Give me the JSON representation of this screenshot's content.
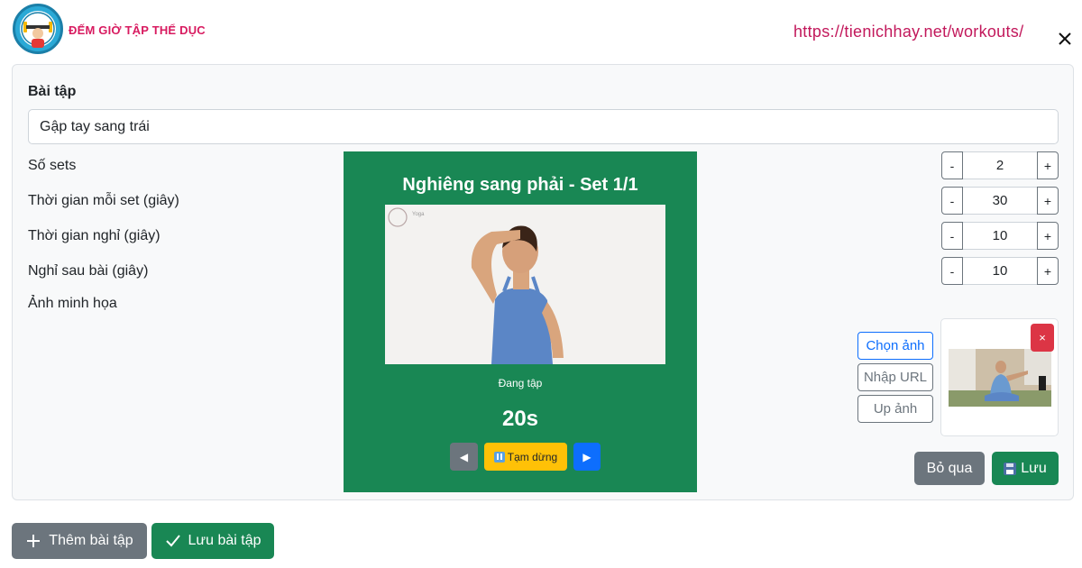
{
  "header": {
    "brand": "ĐẾM GIỜ TẬP THỂ DỤC",
    "url": "https://tienichhay.net/workouts/",
    "logo_icon": "timer-dumbbell-logo",
    "close_icon": "close-icon"
  },
  "form": {
    "exercise_label": "Bài tập",
    "exercise_name": "Gập tay sang trái",
    "sets_label": "Số sets",
    "set_time_label": "Thời gian mỗi set (giây)",
    "rest_label": "Thời gian nghỉ (giây)",
    "rest_after_label": "Nghỉ sau bài (giây)",
    "image_label": "Ảnh minh họa",
    "steppers": {
      "minus": "-",
      "plus": "+",
      "sets": "2",
      "set_time": "30",
      "rest": "10",
      "rest_after": "10"
    }
  },
  "preview": {
    "title": "Nghiêng sang phải - Set 1/1",
    "image_watermark": "Yoga",
    "status": "Đang tập",
    "timer": "20s",
    "prev": "◀",
    "pause": "Tạm dừng",
    "next": "▶"
  },
  "image_picker": {
    "choose": "Chọn ảnh",
    "enter_url": "Nhập URL",
    "upload": "Up ảnh",
    "delete": "×"
  },
  "actions": {
    "skip": "Bỏ qua",
    "save": "Lưu"
  },
  "bottom": {
    "add_exercise": "Thêm bài tập",
    "save_exercises": "Lưu bài tập"
  },
  "colors": {
    "brand": "#d81b60",
    "success": "#198754",
    "secondary": "#6c757d",
    "primary": "#0d6efd",
    "warning": "#ffc107",
    "danger": "#dc3545"
  }
}
